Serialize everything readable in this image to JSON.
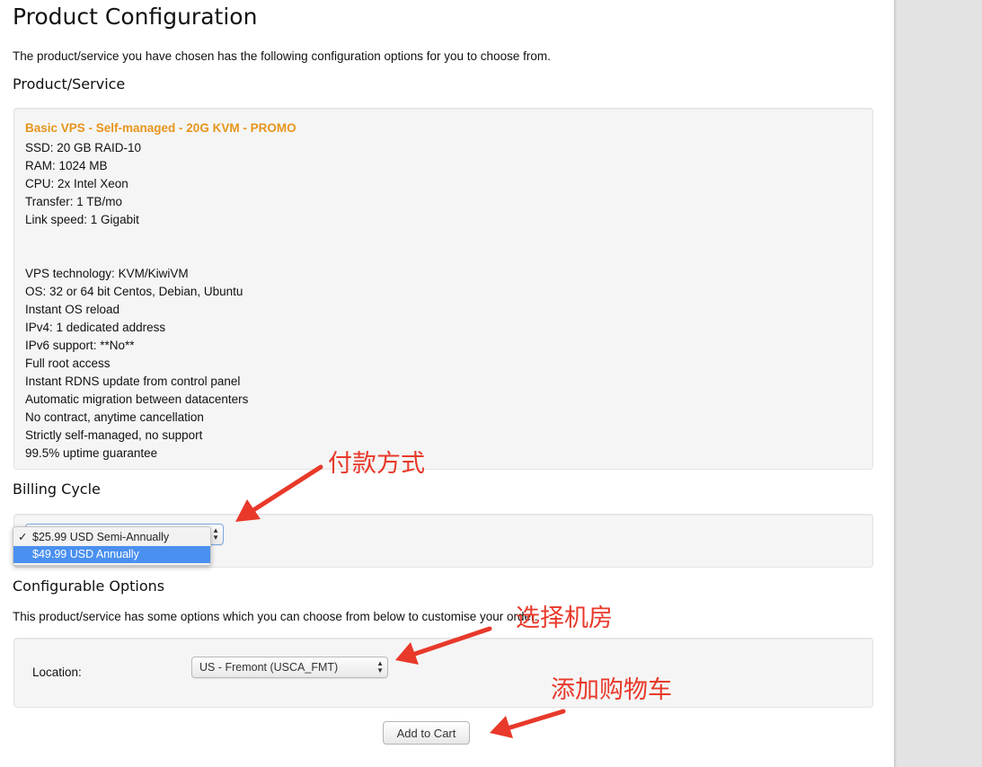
{
  "page": {
    "title": "Product Configuration",
    "intro": "The product/service you have chosen has the following configuration options for you to choose from."
  },
  "product": {
    "heading": "Product/Service",
    "name": "Basic VPS - Self-managed - 20G KVM - PROMO",
    "specs": [
      "SSD: 20 GB RAID-10",
      "RAM: 1024 MB",
      "CPU: 2x Intel Xeon",
      "Transfer: 1 TB/mo",
      "Link speed: 1 Gigabit",
      "",
      "",
      "VPS technology: KVM/KiwiVM",
      "OS: 32 or 64 bit Centos, Debian, Ubuntu",
      "Instant OS reload",
      "IPv4: 1 dedicated address",
      "IPv6 support: **No**",
      "Full root access",
      "Instant RDNS update from control panel",
      "Automatic migration between datacenters",
      "No contract, anytime cancellation",
      "Strictly self-managed, no support",
      "99.5% uptime guarantee"
    ]
  },
  "billing": {
    "heading": "Billing Cycle",
    "options": [
      {
        "label": "$25.99 USD Semi-Annually",
        "checked": true
      },
      {
        "label": "$49.99 USD Annually",
        "highlighted": true
      }
    ],
    "check_glyph": "✓"
  },
  "config": {
    "heading": "Configurable Options",
    "intro": "This product/service has some options which you can choose from below to customise your order.",
    "location_label": "Location:",
    "location_value": "US - Fremont (USCA_FMT)"
  },
  "cart": {
    "add_label": "Add to Cart"
  },
  "annotations": {
    "payment": "付款方式",
    "datacenter": "选择机房",
    "add_cart": "添加购物车",
    "color": "#e8392a"
  }
}
